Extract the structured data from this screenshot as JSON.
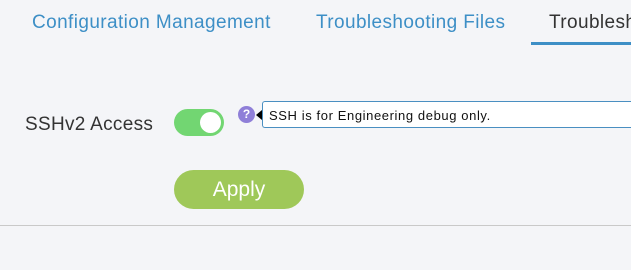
{
  "tabs": [
    {
      "label": "Configuration Management"
    },
    {
      "label": "Troubleshooting Files"
    },
    {
      "label": "Troubleshooting"
    }
  ],
  "active_tab_index": 2,
  "ssh": {
    "label": "SSHv2 Access",
    "enabled": true,
    "help_glyph": "?",
    "tooltip": "SSH is for Engineering debug only."
  },
  "actions": {
    "apply_label": "Apply"
  },
  "colors": {
    "tab_text": "#3d8fc6",
    "active_tab_text": "#333333",
    "toggle_on": "#72d672",
    "help_icon": "#8f7fd8",
    "apply_button": "#9fc859",
    "background": "#f4f5f8"
  },
  "icons": {
    "help": "question-circle-icon",
    "tooltip_pointer": "caret-left-icon"
  }
}
